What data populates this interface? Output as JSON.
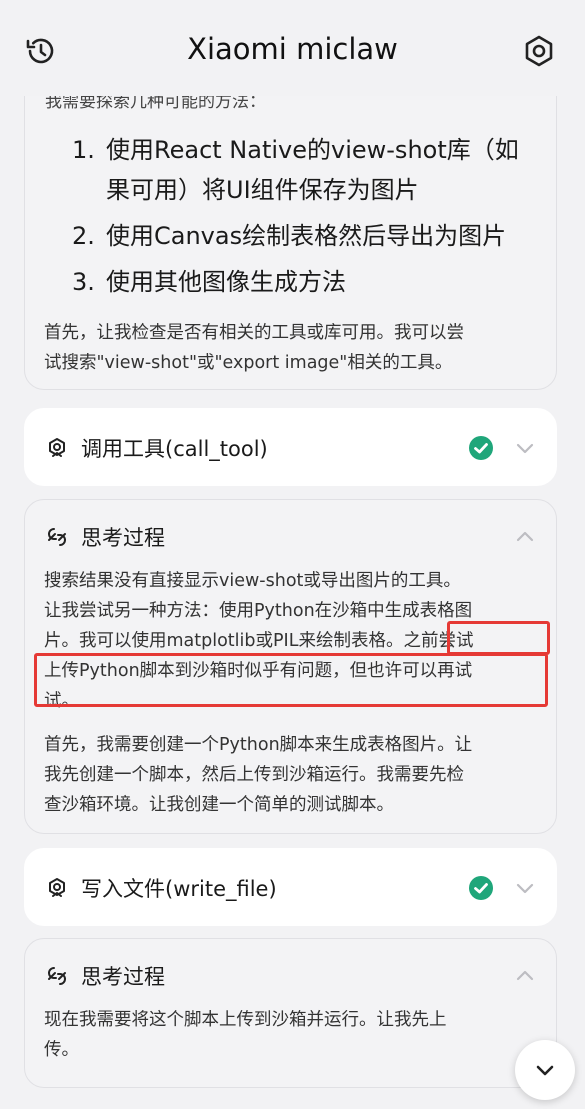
{
  "header": {
    "title": "Xiaomi miclaw",
    "history_icon": "history-icon",
    "settings_icon": "settings-icon"
  },
  "card1": {
    "clipped_text": "我需要探索几种可能的方法：",
    "steps": [
      {
        "num": "1.",
        "lines": [
          "使用React Native的view-shot库（如",
          "果可用）将UI组件保存为图片"
        ]
      },
      {
        "num": "2.",
        "lines": [
          "使用Canvas绘制表格然后导出为图片"
        ]
      },
      {
        "num": "3.",
        "lines": [
          "使用其他图像生成方法"
        ]
      }
    ],
    "para_lines": [
      "首先，让我检查是否有相关的工具或库可用。我可以尝",
      "试搜索\"view-shot\"或\"export image\"相关的工具。"
    ]
  },
  "tool_call": {
    "label": "调用工具(call_tool)",
    "icon": "tool-icon",
    "status_icon": "check-circle-icon",
    "status_color": "#1fa67a"
  },
  "think1": {
    "label": "思考过程",
    "icon": "think-icon",
    "lines": [
      "搜索结果没有直接显示view-shot或导出图片的工具。",
      "让我尝试另一种方法：使用Python在沙箱中生成表格图",
      "片。我可以使用matplotlib或PIL来绘制表格。之前尝试",
      "上传Python脚本到沙箱时似乎有问题，但也许可以再试",
      "试。"
    ],
    "lines2": [
      "首先，我需要创建一个Python脚本来生成表格图片。让",
      "我先创建一个脚本，然后上传到沙箱运行。我需要先检",
      "查沙箱环境。让我创建一个简单的测试脚本。"
    ]
  },
  "tool_write": {
    "label": "写入文件(write_file)",
    "icon": "tool-icon",
    "status_icon": "check-circle-icon"
  },
  "think2": {
    "label": "思考过程",
    "icon": "think-icon",
    "lines": [
      "现在我需要将这个脚本上传到沙箱并运行。让我先上",
      "传。"
    ]
  },
  "colors": {
    "background": "#f2f2f4",
    "highlight": "#e53935",
    "check": "#1fa67a"
  }
}
